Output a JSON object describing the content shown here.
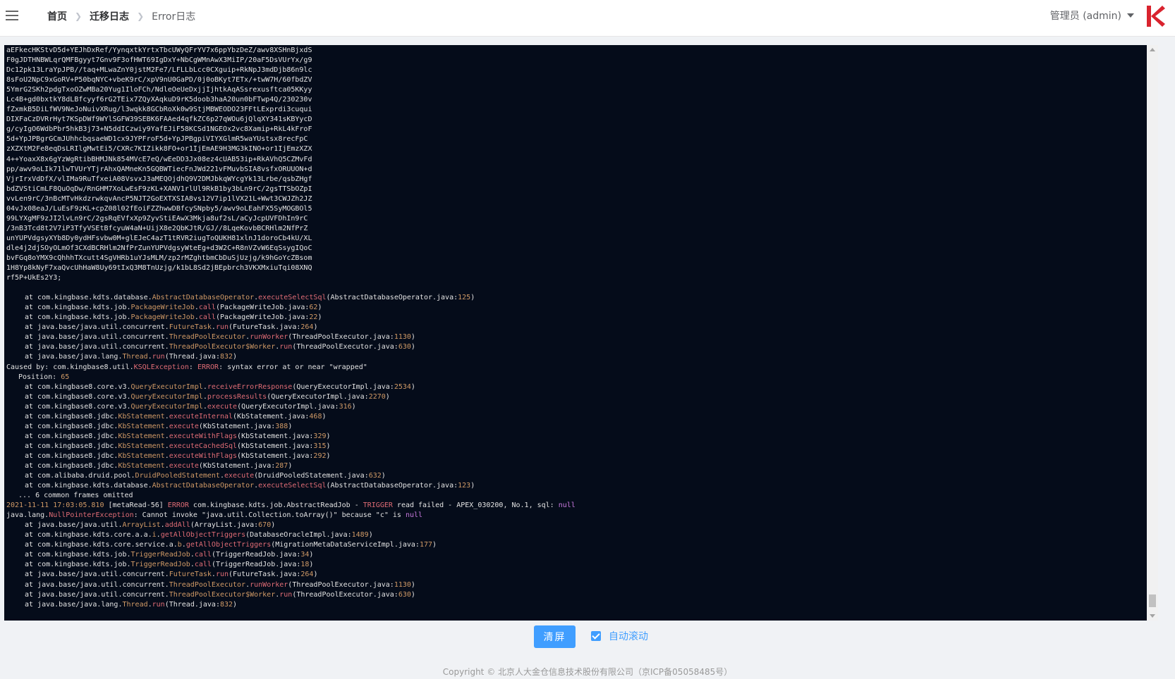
{
  "header": {
    "menu_icon": "hamburger-menu-icon",
    "breadcrumb": [
      "首页",
      "迁移日志",
      "Error日志"
    ],
    "user_label": "管理员 (admin)",
    "logo_color": "#d9232e"
  },
  "log": {
    "base64_lines": [
      "aEFkecHKStvD5d+YEJhDxRef/YynqxtkYrtxTbcUWyQFrYV7x6ppYbzDeZ/awv8XSHnBjxdS",
      "F0gJDTHNBWLqrQMFBgyyt7Gnv9F3ofHWT69IgDxY+NbCgWMnAwX3MiIP/20aF5DsVUrYx/g9",
      "Dc12pk13LraYpJPB//taq+MLwaZnY0jstM2Fe7/LFLLbLcc0CXguip+RkNpJ3mdDjb86n9lc",
      "8sFoU2NpC9xGoRV+P50bqNYC+vbeK9rC/xpV9nU0GaPD/0j0oBKyt7ETx/+twW7H/60fbdZV",
      "5YmrG2SKh2pdgTxoOZwMBa20Yug1IloFCh/NdleOeUeDxjjIjhtkAqASsrexusftca05KKyy",
      "Lc4B+gd0bxtkY8dLBfcyyf6rG2TEix7ZQyXAqkuD9rK5doob3haA20un0bFTwp4Q/230230v",
      "fZxmkB5DiLfWV9NeJoNuivXRug/l3wqkk8GCbRoXk0w9StjMBWEODO23FFtLExprdi3cuqui",
      "DIXFaCzDVRrHyt7KSpDWf9WYlSGFW39SEBK6FAAed4qfkZC6p27qWOu6jQlqXY341sKBYycD",
      "g/cyIgO6WdbPbr5hkB3j73+N5ddICzwiy9YafEJiF58KCSd1NGEOx2vc8Xamip+RkL4kFroF",
      "5d+YpJPBgrGCmJUhhcbqsaeWD1cx9JYPFroF5d+YpJPBgpiVIYXGlmR5waYUstsx8recFpC",
      "zXZXtM2Fe8eqDsLRIlgMwtEi5/CXRc7KIZikk8FO+or1IjEmAE9H3MG3kINO+or1IjEmzXZX",
      "4++YoaxX8x6gYzWgRtibBHMJNk854MVcE7eQ/wEeDD3Jx08ez4cUAB53ip+RkAVhQ5CZMvFd",
      "pp/awv9oLIk71lwTVUrYTjrAhxQAMneKn5GQBWTiecFnJWd221vFMuvbSIA8vsfxORUUON+d",
      "VjrIrxVdDfX/vlIMa9RuTfxeiA08VsvxJ3aMEQOjdhQ9V2DMJbkqWYcgYk13Lrbe/qsbZHgf",
      "bdZVStiCmLF8QuOqDw/RnGHM7XoLwEsF9zKL+XANV1rlUl9RkB1by3bLn9rC/2gsTTSbOZpI",
      "vvLen9rC/3nBcMTvHkdzrwkqvAncP5NJT2GoEXTXSIA8vs12V7ip1lVX21L+Wwt3CWJZh2JZ",
      "04vJx08eaJ/LuEsF9zKL+cpZ08l02fEoiFZZhwwDBfcySNpby5/awv9oLEahFX5SyMOGBOl5",
      "99LYXgMF9zJI2lvLn9rC/2gsRqEVfxXp9ZyvStiEAwX3Mkja8uf2sL/aCyJcpUVFDhIn9rC",
      "/3nB3Tcd8t2V7iP3TfyVSEtBfcyuW4aN+UijX8e2QbKJtR/GJ//8LqeKovbBCRHlm2NfPrZ",
      "unYUPVdgsyXYb8Dy0ydHFsvbw0M+glEJeC4azT1tRVR2iugToQUKH81xlnJ1doroCb4kU/XL",
      "dle4j2djSOyOLmOf3CXdBCRHlm2NfPrZunYUPVdgsyWteEg+d3W2C+R8nVZvW6EqSsygIQoC",
      "bvFGq8oYMX9cQhhhTXcutt4SgVHRb1uYJsMLM/zp2rMZghtbmCbDuSjUzjg/k9hGoYcZBsom",
      "1H8Yp8kNyF7xaQvcUhHaW8Uy69tIxQ3M8TnUzjg/k1bL8Sd2jBEpbrch3VKXMxiuTqi08XNQ",
      "rf5P+UkEs2Y3;"
    ],
    "stack1": [
      [
        "com.kingbase.kdts.database.AbstractDatabaseOperator.executeSelectSql",
        "AbstractDatabaseOperator.java:125"
      ],
      [
        "com.kingbase.kdts.job.PackageWriteJob.call",
        "PackageWriteJob.java:62"
      ],
      [
        "com.kingbase.kdts.job.PackageWriteJob.call",
        "PackageWriteJob.java:22"
      ],
      [
        "java.base/java.util.concurrent.FutureTask.run",
        "FutureTask.java:264"
      ],
      [
        "java.base/java.util.concurrent.ThreadPoolExecutor.runWorker",
        "ThreadPoolExecutor.java:1130"
      ],
      [
        "java.base/java.util.concurrent.ThreadPoolExecutor$Worker.run",
        "ThreadPoolExecutor.java:630"
      ],
      [
        "java.base/java.lang.Thread.run",
        "Thread.java:832"
      ]
    ],
    "caused_by": "Caused by: com.kingbase8.util.KSQLException: ERROR: syntax error at or near \"wrapped\"",
    "position": "Position: 65",
    "stack2": [
      [
        "com.kingbase8.core.v3.QueryExecutorImpl.receiveErrorResponse",
        "QueryExecutorImpl.java:2534"
      ],
      [
        "com.kingbase8.core.v3.QueryExecutorImpl.processResults",
        "QueryExecutorImpl.java:2270"
      ],
      [
        "com.kingbase8.core.v3.QueryExecutorImpl.execute",
        "QueryExecutorImpl.java:316"
      ],
      [
        "com.kingbase8.jdbc.KbStatement.executeInternal",
        "KbStatement.java:468"
      ],
      [
        "com.kingbase8.jdbc.KbStatement.execute",
        "KbStatement.java:388"
      ],
      [
        "com.kingbase8.jdbc.KbStatement.executeWithFlags",
        "KbStatement.java:329"
      ],
      [
        "com.kingbase8.jdbc.KbStatement.executeCachedSql",
        "KbStatement.java:315"
      ],
      [
        "com.kingbase8.jdbc.KbStatement.executeWithFlags",
        "KbStatement.java:292"
      ],
      [
        "com.kingbase8.jdbc.KbStatement.execute",
        "KbStatement.java:287"
      ],
      [
        "com.alibaba.druid.pool.DruidPooledStatement.execute",
        "DruidPooledStatement.java:632"
      ],
      [
        "com.kingbase.kdts.database.AbstractDatabaseOperator.executeSelectSql",
        "AbstractDatabaseOperator.java:123"
      ]
    ],
    "omitted": "... 6 common frames omitted",
    "error_line": "2021-11-11 17:03:05.810 [metaRead-56] ERROR com.kingbase.kdts.job.AbstractReadJob - TRIGGER read failed - APEX_030200, No.1, sql: null",
    "npe_line": "java.lang.NullPointerException: Cannot invoke \"java.util.Collection.toArray()\" because \"c\" is null",
    "stack3": [
      [
        "java.base/java.util.ArrayList.addAll",
        "ArrayList.java:670"
      ],
      [
        "com.kingbase.kdts.core.a.a.i.getAllObjectTriggers",
        "DatabaseOracleImpl.java:1489"
      ],
      [
        "com.kingbase.kdts.core.service.a.b.getAllObjectTriggers",
        "MigrationMetaDataServiceImpl.java:177"
      ],
      [
        "com.kingbase.kdts.job.TriggerReadJob.call",
        "TriggerReadJob.java:34"
      ],
      [
        "com.kingbase.kdts.job.TriggerReadJob.call",
        "TriggerReadJob.java:18"
      ],
      [
        "java.base/java.util.concurrent.FutureTask.run",
        "FutureTask.java:264"
      ],
      [
        "java.base/java.util.concurrent.ThreadPoolExecutor.runWorker",
        "ThreadPoolExecutor.java:1130"
      ],
      [
        "java.base/java.util.concurrent.ThreadPoolExecutor$Worker.run",
        "ThreadPoolExecutor.java:630"
      ],
      [
        "java.base/java.lang.Thread.run",
        "Thread.java:832"
      ]
    ]
  },
  "controls": {
    "clear_button": "清屏",
    "auto_scroll_label": "自动滚动",
    "auto_scroll_checked": true
  },
  "footer": {
    "copyright": "Copyright © 北京人大金仓信息技术股份有限公司（京ICP备05058485号）"
  },
  "colors": {
    "console_bg": "#050c1a",
    "primary": "#409eff"
  }
}
